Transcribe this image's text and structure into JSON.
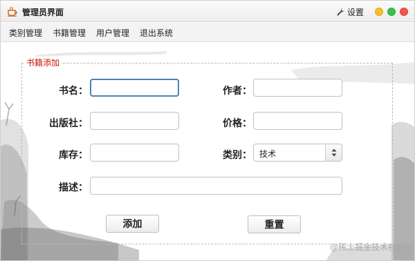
{
  "window": {
    "title": "管理员界面",
    "settings_label": "设置"
  },
  "menu": {
    "items": [
      "类别管理",
      "书籍管理",
      "用户管理",
      "退出系统"
    ]
  },
  "form": {
    "group_title": "书籍添加",
    "labels": {
      "name": "书名：",
      "author": "作者：",
      "publisher": "出版社：",
      "price": "价格：",
      "stock": "库存：",
      "category": "类别：",
      "description": "描述："
    },
    "values": {
      "name": "",
      "author": "",
      "publisher": "",
      "price": "",
      "stock": "",
      "description": ""
    },
    "category_selected": "技术",
    "buttons": {
      "add": "添加",
      "reset": "重置"
    }
  },
  "watermark": "@稀土掘金技术社区",
  "colors": {
    "group_title": "#c8140a",
    "focus_border": "#4d7fb0"
  },
  "icons": {
    "app": "coffee-cup-icon",
    "settings": "wrench-icon",
    "select_arrows": "up-down-arrows-icon"
  }
}
